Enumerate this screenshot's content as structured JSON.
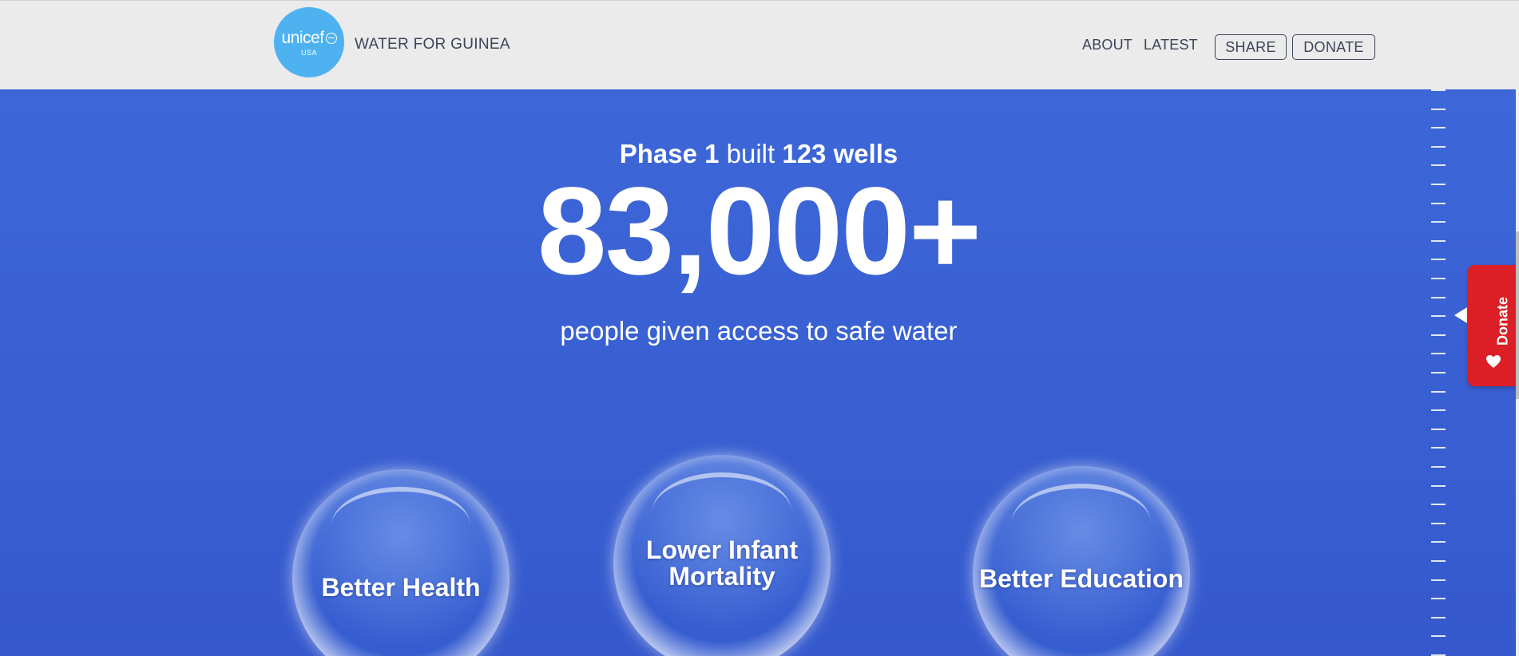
{
  "header": {
    "logo": {
      "word": "unicef",
      "sub": "USA"
    },
    "site_title": "WATER FOR GUINEA",
    "nav": {
      "about": "ABOUT",
      "latest": "LATEST",
      "share": "SHARE",
      "donate": "DONATE"
    }
  },
  "hero": {
    "phase_label": "Phase 1",
    "built_text": "built",
    "wells_text": "123 wells",
    "big_number": "83,000+",
    "subtitle": "people given access to safe water"
  },
  "bubbles": [
    {
      "label": "Better Health"
    },
    {
      "label_line1": "Lower Infant",
      "label_line2": "Mortality"
    },
    {
      "label": "Better Education"
    }
  ],
  "donate_tab": {
    "label": "Donate",
    "icon": "heart-icon"
  },
  "colors": {
    "background": "#3a62d6",
    "header": "#ebebeb",
    "logo": "#4eb2f1",
    "donate": "#dc1f26"
  }
}
